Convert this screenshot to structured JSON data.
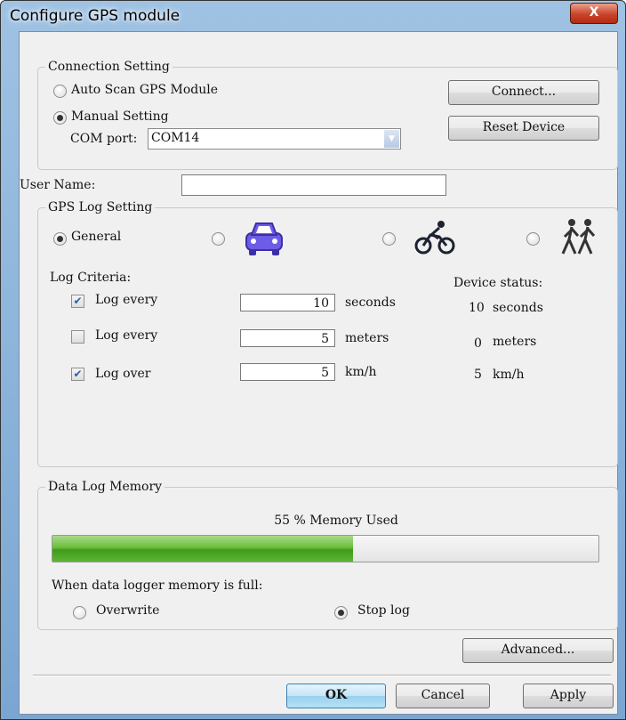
{
  "window": {
    "title": "Configure GPS module",
    "close_label": "X"
  },
  "connection": {
    "legend": "Connection Setting",
    "auto_scan_label": "Auto Scan GPS Module",
    "auto_scan_selected": false,
    "manual_label": "Manual Setting",
    "manual_selected": true,
    "com_port_label": "COM port:",
    "com_port_value": "COM14",
    "connect_label": "Connect...",
    "reset_label": "Reset Device"
  },
  "user": {
    "label": "User Name:",
    "value": ""
  },
  "gps_log": {
    "legend": "GPS Log Setting",
    "profiles": [
      {
        "label": "General",
        "icon": "general",
        "selected": true
      },
      {
        "label": "",
        "icon": "car-icon",
        "selected": false
      },
      {
        "label": "",
        "icon": "bicycle-icon",
        "selected": false
      },
      {
        "label": "",
        "icon": "hiker-icon",
        "selected": false
      }
    ],
    "criteria_label": "Log Criteria:",
    "device_status_label": "Device status:",
    "criteria": [
      {
        "checked": true,
        "label": "Log every",
        "value": "10",
        "unit": "seconds",
        "status_value": "10",
        "status_unit": "seconds"
      },
      {
        "checked": false,
        "label": "Log every",
        "value": "5",
        "unit": "meters",
        "status_value": "0",
        "status_unit": "meters"
      },
      {
        "checked": true,
        "label": "Log over",
        "value": "5",
        "unit": "km/h",
        "status_value": "5",
        "status_unit": "km/h"
      }
    ]
  },
  "memory": {
    "legend": "Data Log Memory",
    "used_text": "55 % Memory Used",
    "used_fraction": 0.55,
    "full_label": "When data logger memory is full:",
    "overwrite_label": "Overwrite",
    "overwrite_selected": false,
    "stop_label": "Stop log",
    "stop_selected": true
  },
  "buttons": {
    "advanced": "Advanced...",
    "ok": "OK",
    "cancel": "Cancel",
    "apply": "Apply"
  },
  "colors": {
    "progress_fill": "#5db533",
    "car_icon": "#6d5ce6",
    "bike_icon": "#1c2230",
    "hiker_icon": "#333"
  }
}
